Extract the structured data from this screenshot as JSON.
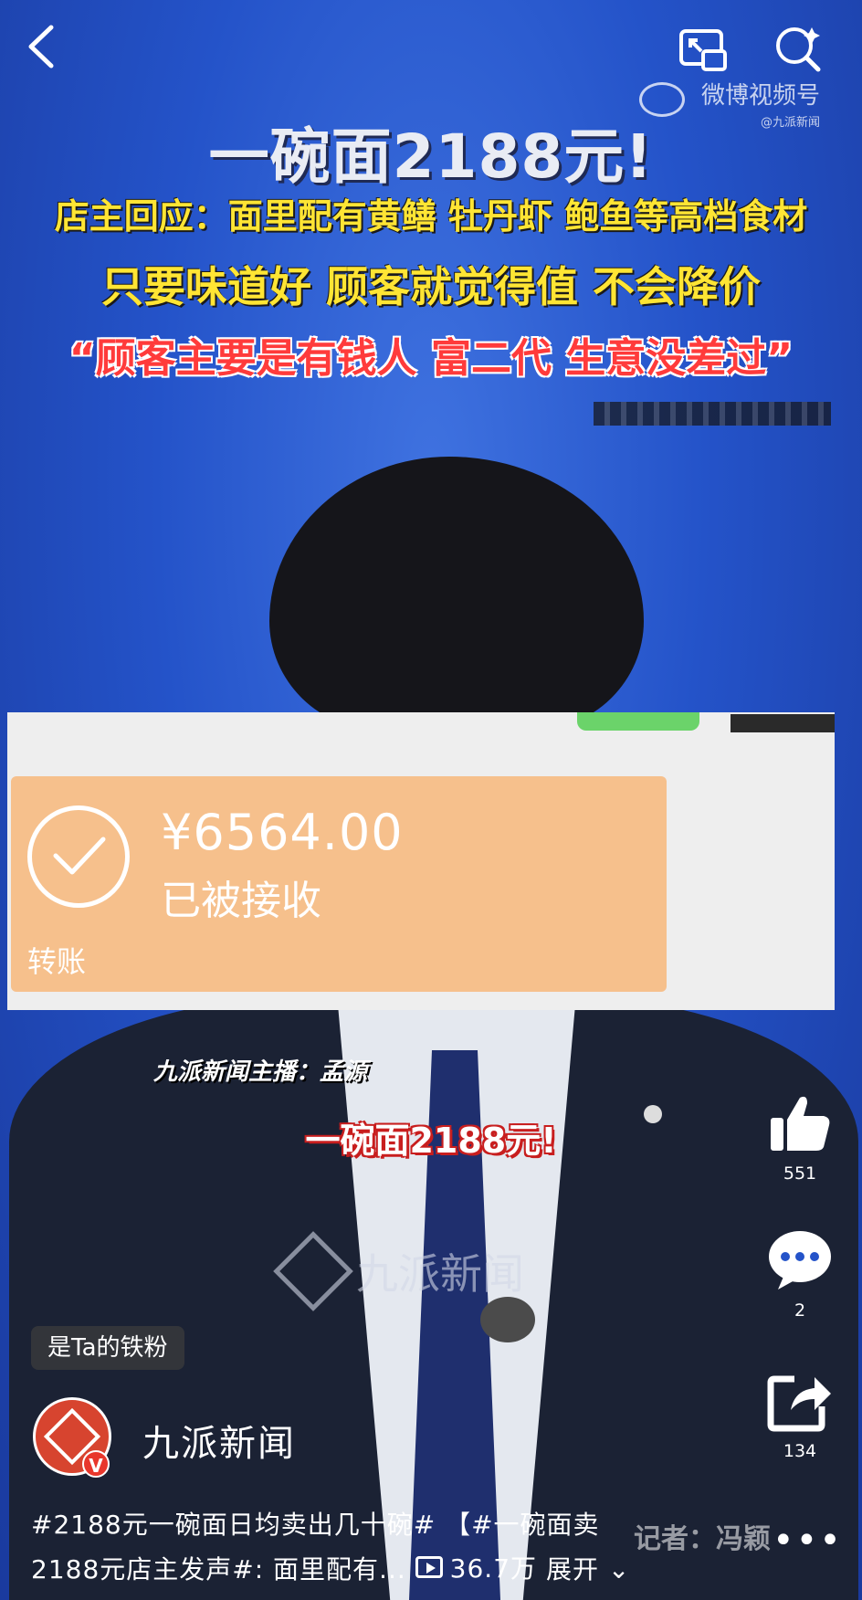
{
  "video": {
    "headline": "一碗面2188元!",
    "line1": "店主回应：面里配有黄鳝 牡丹虾 鲍鱼等高档食材",
    "line2": "只要味道好 顾客就觉得值 不会降价",
    "line3": "“顾客主要是有钱人 富二代 生意没差过”",
    "watermark_brand": "微博视频号",
    "watermark_handle": "@九派新闻",
    "anchor_label": "九派新闻主播：孟源",
    "subtitle": "一碗面2188元!",
    "channel_watermark": "九派新闻"
  },
  "payment_card": {
    "amount": "¥6564.00",
    "status": "已被接收",
    "type": "转账"
  },
  "actions": {
    "like_count": "551",
    "comment_count": "2",
    "share_count": "134"
  },
  "fan_badge": "是Ta的铁粉",
  "author": {
    "name": "九派新闻"
  },
  "caption": {
    "line1": "#2188元一碗面日均卖出几十碗# 【#一碗面卖",
    "line2": "2188元店主发声#: 面里配有...",
    "views": "36.7万",
    "expand": "展开"
  },
  "reporter": "记者：冯颖",
  "more": "•••",
  "colors": {
    "headline_yellow": "#ffe534",
    "quote_red": "#ff3b3b",
    "card_orange": "#f6c08c",
    "background_blue": "#2453c9"
  }
}
